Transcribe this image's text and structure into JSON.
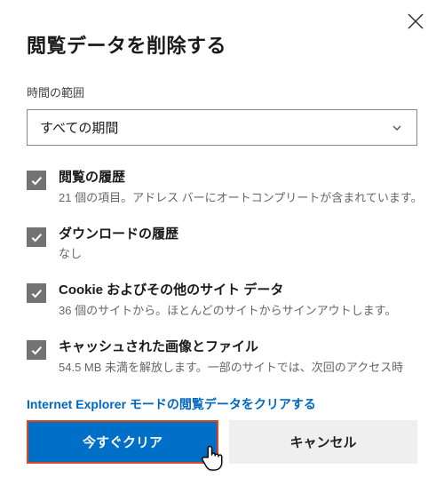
{
  "title": "閲覧データを削除する",
  "timeRangeLabel": "時間の範囲",
  "timeRangeValue": "すべての期間",
  "options": [
    {
      "title": "閲覧の履歴",
      "desc": "21 個の項目。アドレス バーにオートコンプリートが含まれています。"
    },
    {
      "title": "ダウンロードの履歴",
      "desc": "なし"
    },
    {
      "title": "Cookie およびその他のサイト データ",
      "desc": "36 個のサイトから。ほとんどのサイトからサインアウトします。"
    },
    {
      "title": "キャッシュされた画像とファイル",
      "desc": "54.5 MB 未満を解放します。一部のサイトでは、次回のアクセス時"
    }
  ],
  "ieLink": "Internet Explorer モードの閲覧データをクリアする",
  "primaryBtn": "今すぐクリア",
  "secondaryBtn": "キャンセル"
}
